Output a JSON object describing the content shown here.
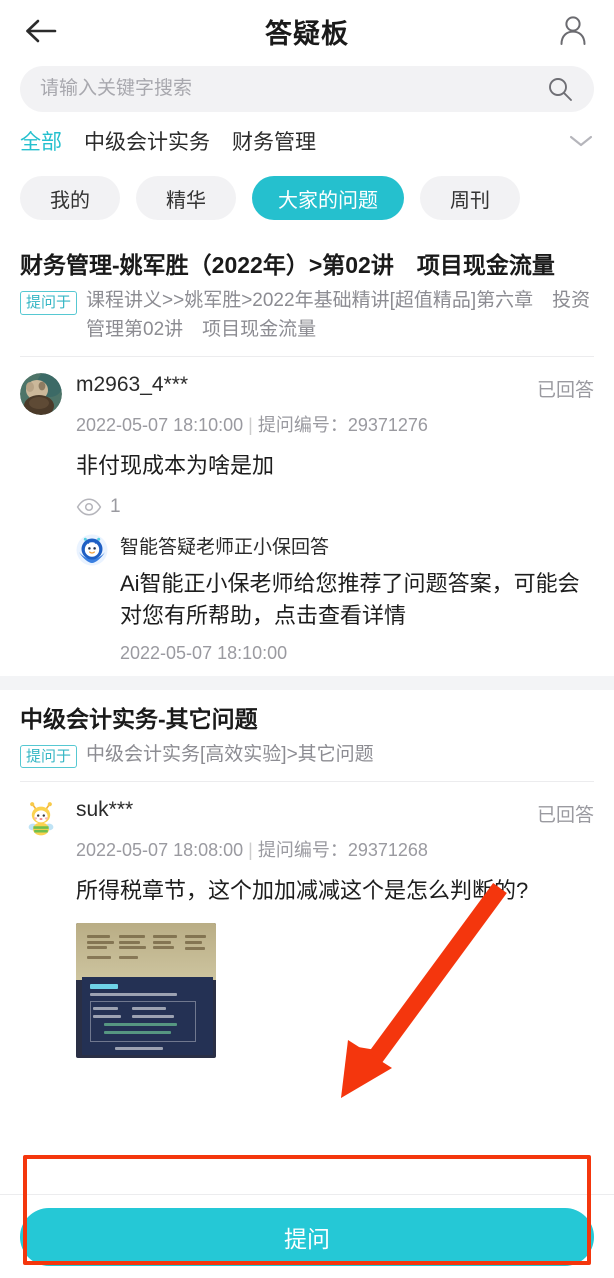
{
  "header": {
    "title": "答疑板",
    "back_icon": "arrow-left-icon",
    "user_icon": "user-avatar-icon"
  },
  "search": {
    "placeholder": "请输入关键字搜索",
    "value": "",
    "icon": "search-icon"
  },
  "categories": {
    "items": [
      {
        "label": "全部",
        "active": true
      },
      {
        "label": "中级会计实务",
        "active": false
      },
      {
        "label": "财务管理",
        "active": false
      }
    ],
    "expand_icon": "chevron-down-icon"
  },
  "chips": [
    {
      "label": "我的",
      "active": false
    },
    {
      "label": "精华",
      "active": false
    },
    {
      "label": "大家的问题",
      "active": true
    },
    {
      "label": "周刊",
      "active": false
    }
  ],
  "cards": [
    {
      "title": "财务管理-姚军胜（2022年）>第02讲　项目现金流量",
      "ask_tag": "提问于",
      "ask_path": "课程讲义>>姚军胜>2022年基础精讲[超值精品]第六章　投资管理第02讲　项目现金流量",
      "question": {
        "user": "m2963_4***",
        "status": "已回答",
        "time": "2022-05-07 18:10:00",
        "id_label": "提问编号：",
        "id_value": "29371276",
        "body": "非付现成本为啥是加",
        "views_icon": "eye-icon",
        "views": "1"
      },
      "answer": {
        "avatar_icon": "ai-robot-icon",
        "name": "智能答疑老师正小保回答",
        "text": "Ai智能正小保老师给您推荐了问题答案，可能会对您有所帮助，点击查看详情",
        "time": "2022-05-07 18:10:00"
      }
    },
    {
      "title": "中级会计实务-其它问题",
      "ask_tag": "提问于",
      "ask_path": "中级会计实务[高效实验]>其它问题",
      "question": {
        "user": "suk***",
        "status": "已回答",
        "time": "2022-05-07 18:08:00",
        "id_label": "提问编号：",
        "id_value": "29371268",
        "body": "所得税章节，这个加加减减这个是怎么判断的?",
        "attachment_alt": "讲义截图"
      }
    }
  ],
  "bottom": {
    "ask_button": "提问"
  },
  "annotation": {
    "arrow_color": "#f4360d",
    "box_color": "#f4360d"
  },
  "theme": {
    "accent": "#25c0ce",
    "button": "#25c8d6",
    "muted": "#9a9aa0"
  }
}
